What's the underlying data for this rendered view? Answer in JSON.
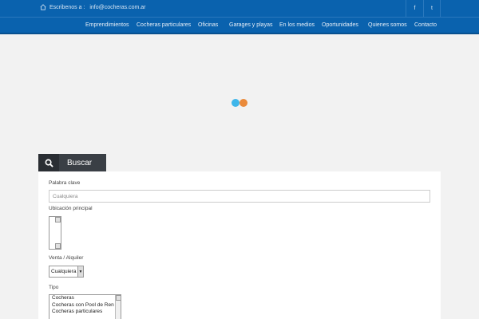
{
  "topbar": {
    "contact_prefix": "Escribenos a :",
    "contact_email": "info@cocheras.com.ar",
    "icons": [
      "house-icon",
      "facebook-icon",
      "twitter-icon"
    ],
    "facebook_glyph": "f",
    "twitter_glyph": "t"
  },
  "nav": {
    "items": [
      "Emprendimientos",
      "Cocheras particulares",
      "Oficinas",
      "Garages y playas",
      "En los medios",
      "Oportunidades",
      "Quienes somos",
      "Contacto"
    ]
  },
  "loader": {
    "colors": [
      "#3fb6ea",
      "#ea8a3a"
    ]
  },
  "search": {
    "tab_label": "Buscar",
    "keyword_label": "Palabra clave",
    "keyword_placeholder": "Cualquiera",
    "location_label": "Ubicación principal",
    "venta_label": "Venta / Alquiler",
    "venta_selected": "Cualquiera",
    "tipo_label": "Tipo",
    "tipo_options": [
      "Cocheras",
      "Cocheras con Pool de Ren",
      "Cocheras particulares"
    ]
  },
  "colors": {
    "brand_blue": "#0a62ae",
    "tab_dark": "#3a3f45"
  }
}
